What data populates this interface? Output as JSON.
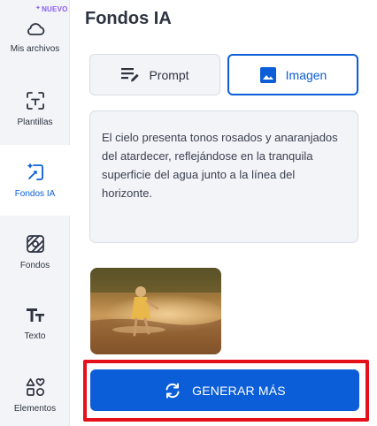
{
  "sidebar": {
    "badge": "NUEVO",
    "items": [
      {
        "label": "Mis archivos",
        "icon": "cloud-icon"
      },
      {
        "label": "Plantillas",
        "icon": "template-icon"
      },
      {
        "label": "Fondos IA",
        "icon": "ai-background-icon",
        "active": true
      },
      {
        "label": "Fondos",
        "icon": "backgrounds-icon"
      },
      {
        "label": "Texto",
        "icon": "text-icon"
      },
      {
        "label": "Elementos",
        "icon": "elements-icon"
      }
    ]
  },
  "main": {
    "title": "Fondos IA",
    "tabs": [
      {
        "label": "Prompt",
        "icon": "prompt-edit-icon",
        "selected": false
      },
      {
        "label": "Imagen",
        "icon": "image-icon",
        "selected": true
      }
    ],
    "prompt_text": "El cielo presenta tonos rosados y anaranjados del atardecer, reflejándose en la tranquila superficie del agua junto a la línea del horizonte.",
    "generate_button": {
      "label": "GENERAR MÁS",
      "icon": "refresh-icon"
    }
  },
  "colors": {
    "accent": "#0b5ed7",
    "highlight": "#e5101a",
    "badge": "#8b5cf6",
    "sidebar_bg": "#f3f4f8"
  }
}
